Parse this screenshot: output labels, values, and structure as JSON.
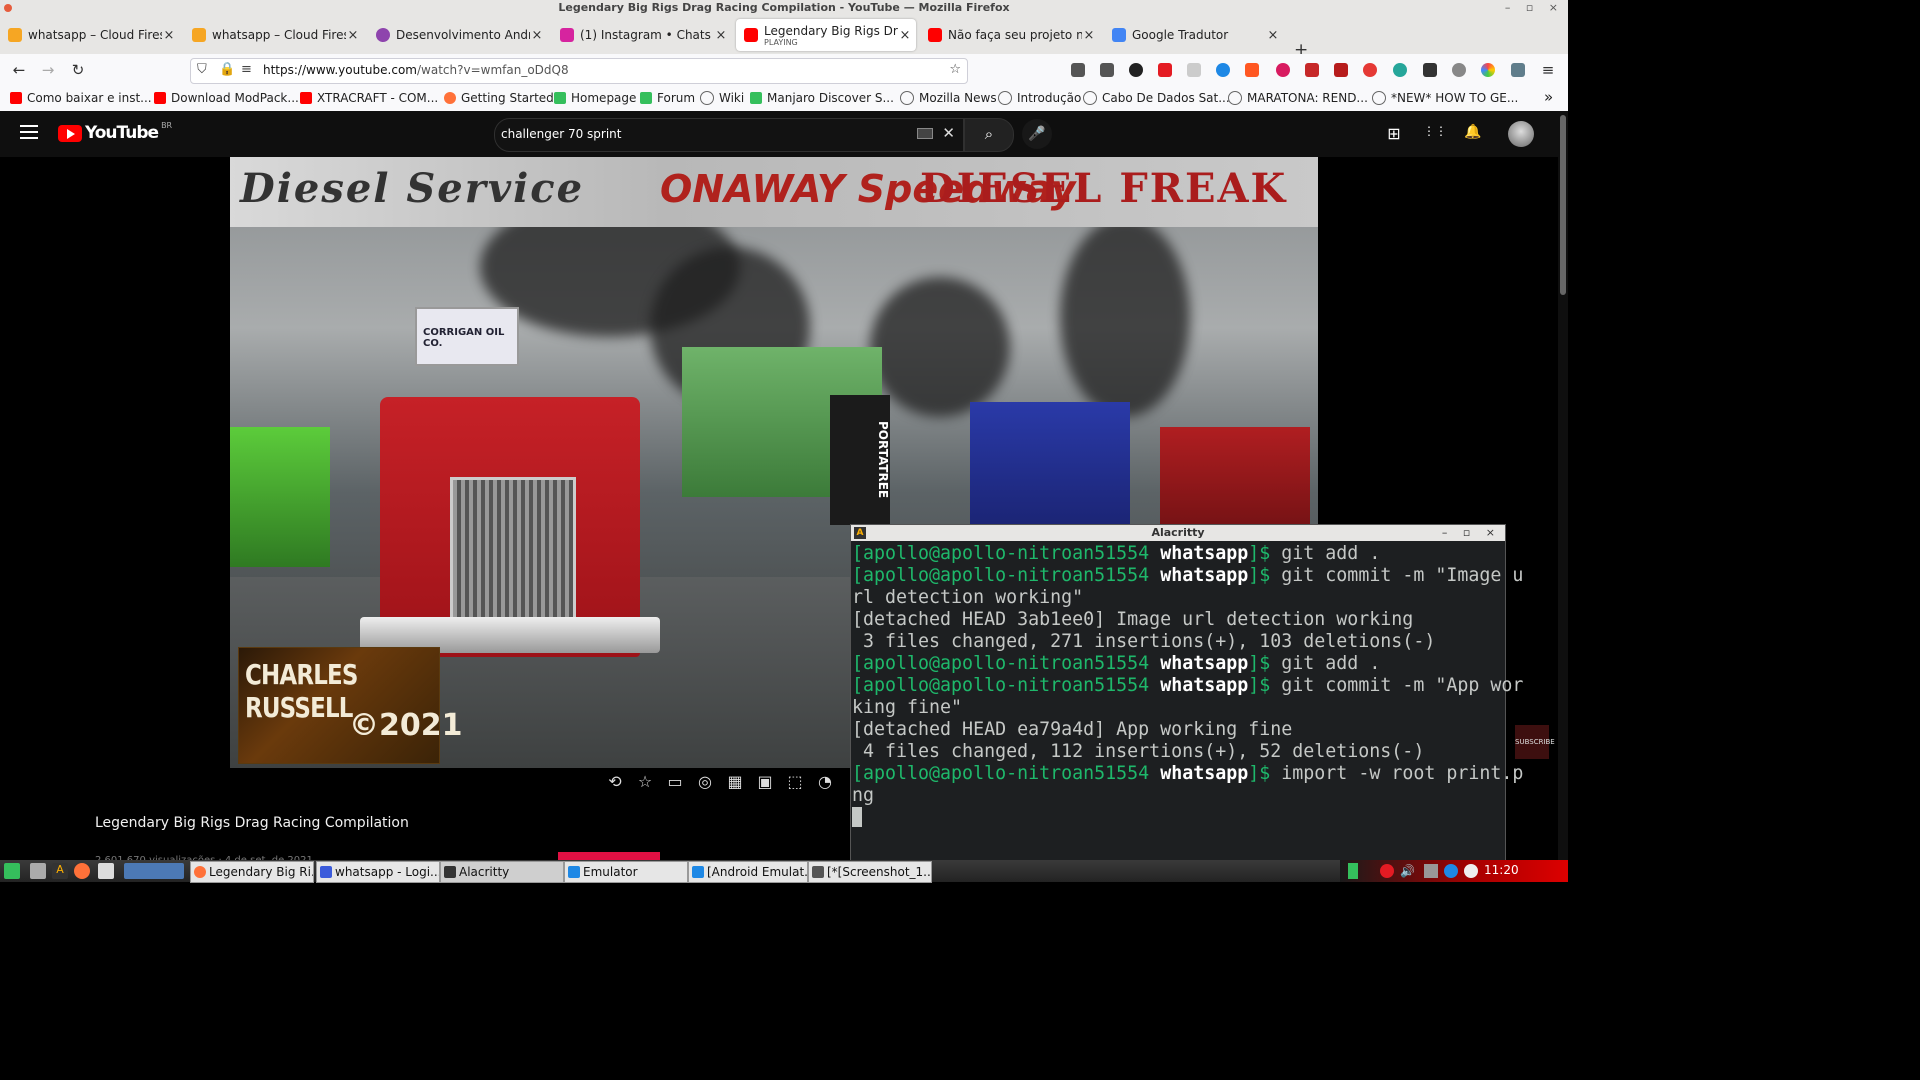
{
  "window": {
    "title": "Legendary Big Rigs Drag Racing Compilation - YouTube — Mozilla Firefox",
    "controls": "– ▫ ×"
  },
  "tabs": [
    {
      "label": "whatsapp – Cloud Firesto",
      "favicon": "firebase-icon",
      "color": "#f6a623"
    },
    {
      "label": "whatsapp – Cloud Firesto",
      "favicon": "firebase-icon",
      "color": "#f6a623"
    },
    {
      "label": "Desenvolvimento Androi",
      "favicon": "udemy-icon",
      "color": "#8e44ad"
    },
    {
      "label": "(1) Instagram • Chats",
      "favicon": "instagram-icon",
      "color": "#d6249f"
    },
    {
      "label": "Legendary Big Rigs Drag",
      "sub": "PLAYING",
      "favicon": "youtube-icon",
      "color": "#ff0000",
      "active": true
    },
    {
      "label": "Não faça seu projeto no",
      "favicon": "youtube-icon",
      "color": "#ff0000"
    },
    {
      "label": "Google Tradutor",
      "favicon": "translate-icon",
      "color": "#4285f4"
    }
  ],
  "tab_close": "×",
  "new_tab": "+",
  "nav": {
    "back": "←",
    "forward": "→",
    "reload": "↻",
    "url_host": "https://www.youtube.com",
    "url_path": "/watch?v=wmfan_oDdQ8"
  },
  "bookmarks": [
    {
      "label": "Como baixar e inst...",
      "color": "#ff0000"
    },
    {
      "label": "Download ModPack...",
      "color": "#ff0000"
    },
    {
      "label": "XTRACRAFT - COM...",
      "color": "#ff0000"
    },
    {
      "label": "Getting Started",
      "color": "#ff7139"
    },
    {
      "label": "Homepage",
      "color": "#35bf5c"
    },
    {
      "label": "Forum",
      "color": "#35bf5c"
    },
    {
      "label": "Wiki",
      "color": "#666666"
    },
    {
      "label": "Manjaro Discover S...",
      "color": "#35bf5c"
    },
    {
      "label": "Mozilla News",
      "color": "#666666"
    },
    {
      "label": "Introdução",
      "color": "#666666"
    },
    {
      "label": "Cabo De Dados Sat...",
      "color": "#666666"
    },
    {
      "label": "MARATONA: REND...",
      "color": "#666666"
    },
    {
      "label": "*NEW* HOW TO GE...",
      "color": "#666666"
    }
  ],
  "bookmarks_overflow": "»",
  "youtube": {
    "logo_text": "YouTube",
    "country": "BR",
    "search_value": "challenger 70 sprint",
    "search_clear": "✕",
    "search_icon": "⌕",
    "mic_icon": "🎤",
    "create_icon": "⊞",
    "apps_icon": "⋮⋮",
    "bell_icon": "🔔",
    "video_title": "Legendary Big Rigs Drag Racing Compilation",
    "meta": "2.601.670 visualizações · 4 de set. de 2021",
    "subscribe_badge": "SUBSCRIBE",
    "controls": [
      "⟲",
      "☆",
      "▭",
      "◎",
      "▦",
      "▣",
      "⬚",
      "◔",
      "▯"
    ]
  },
  "video": {
    "banner_left": "Diesel Service",
    "banner_mid": "ONAWAY Speedway",
    "banner_right": "DIESEL FREAK",
    "watermark_line1": "CHARLES RUSSELL",
    "watermark_line2": "©2021",
    "sign_oil": "CORRIGAN OIL CO.",
    "tree_text": "PORTATREE"
  },
  "terminal": {
    "title": "Alacritty",
    "controls": "– ▫ ×",
    "prompt_user": "[apollo@apollo-nitroan51554",
    "prompt_dir": "whatsapp",
    "prompt_sym": "]$",
    "lines": [
      {
        "type": "prompt",
        "cmd": " git add ."
      },
      {
        "type": "prompt",
        "cmd": " git commit -m \"Image u"
      },
      {
        "type": "out",
        "text": "rl detection working\""
      },
      {
        "type": "out",
        "text": "[detached HEAD 3ab1ee0] Image url detection working"
      },
      {
        "type": "out",
        "text": " 3 files changed, 271 insertions(+), 103 deletions(-)"
      },
      {
        "type": "prompt",
        "cmd": " git add ."
      },
      {
        "type": "prompt",
        "cmd": " git commit -m \"App wor"
      },
      {
        "type": "out",
        "text": "king fine\""
      },
      {
        "type": "out",
        "text": "[detached HEAD ea79a4d] App working fine"
      },
      {
        "type": "out",
        "text": " 4 files changed, 112 insertions(+), 52 deletions(-)"
      },
      {
        "type": "prompt",
        "cmd": " import -w root print.p"
      },
      {
        "type": "out",
        "text": "ng"
      }
    ]
  },
  "taskbar": {
    "tasks": [
      {
        "label": "Legendary Big Ri...",
        "color": "#ff7139"
      },
      {
        "label": "whatsapp - Logi...",
        "color": "#3b5bdb"
      },
      {
        "label": "Alacritty",
        "color": "#333333",
        "active": true
      },
      {
        "label": "Emulator",
        "color": "#1e88e5"
      },
      {
        "label": "[Android Emulat...",
        "color": "#1e88e5"
      },
      {
        "label": "[*[Screenshot_1...",
        "color": "#555555"
      }
    ],
    "red_task_label": "Emulator",
    "clock": "11:20"
  }
}
